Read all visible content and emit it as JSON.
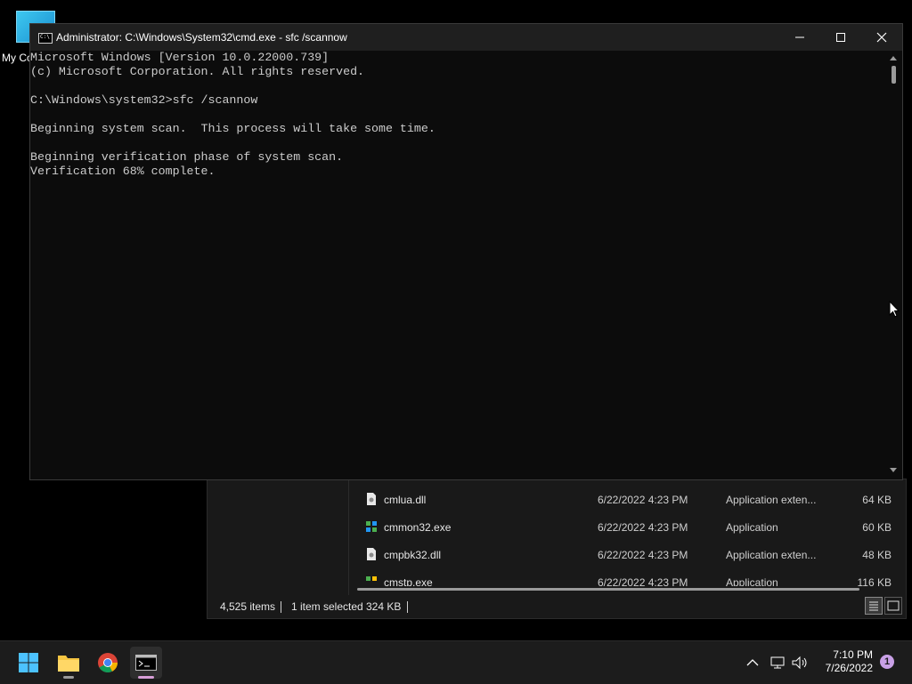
{
  "desktop": {
    "icon_label": "My Co"
  },
  "cmd": {
    "title": "Administrator: C:\\Windows\\System32\\cmd.exe - sfc  /scannow",
    "lines": [
      "Microsoft Windows [Version 10.0.22000.739]",
      "(c) Microsoft Corporation. All rights reserved.",
      "",
      "C:\\Windows\\system32>sfc /scannow",
      "",
      "Beginning system scan.  This process will take some time.",
      "",
      "Beginning verification phase of system scan.",
      "Verification 68% complete."
    ],
    "minimize_glyph": "—",
    "maximize_glyph": "☐",
    "close_glyph": "✕"
  },
  "explorer": {
    "rows": [
      {
        "name": "cmlua.dll",
        "date": "6/22/2022 4:23 PM",
        "type": "Application exten...",
        "size": "64 KB",
        "icon": "dll-file-icon"
      },
      {
        "name": "cmmon32.exe",
        "date": "6/22/2022 4:23 PM",
        "type": "Application",
        "size": "60 KB",
        "icon": "exe-file-icon"
      },
      {
        "name": "cmpbk32.dll",
        "date": "6/22/2022 4:23 PM",
        "type": "Application exten...",
        "size": "48 KB",
        "icon": "dll-file-icon"
      },
      {
        "name": "cmstp.exe",
        "date": "6/22/2022 4:23 PM",
        "type": "Application",
        "size": "116 KB",
        "icon": "exe-file-icon"
      }
    ],
    "status": {
      "items_count": "4,525 items",
      "selected": "1 item selected",
      "selected_size": "324 KB"
    }
  },
  "taskbar": {
    "apps": [
      {
        "name": "start",
        "icon": "windows-logo-icon"
      },
      {
        "name": "file-explorer",
        "icon": "folder-icon"
      },
      {
        "name": "chrome",
        "icon": "chrome-icon"
      },
      {
        "name": "terminal",
        "icon": "cmd-icon",
        "active": true
      }
    ],
    "clock": {
      "time": "7:10 PM",
      "date": "7/26/2022"
    },
    "notification_count": "1"
  },
  "colors": {
    "console_bg": "#0c0c0c",
    "console_text": "#cccccc",
    "titlebar_bg": "#1f1f1f",
    "taskbar_bg": "#1c1c1c",
    "accent": "#d79ed7"
  }
}
